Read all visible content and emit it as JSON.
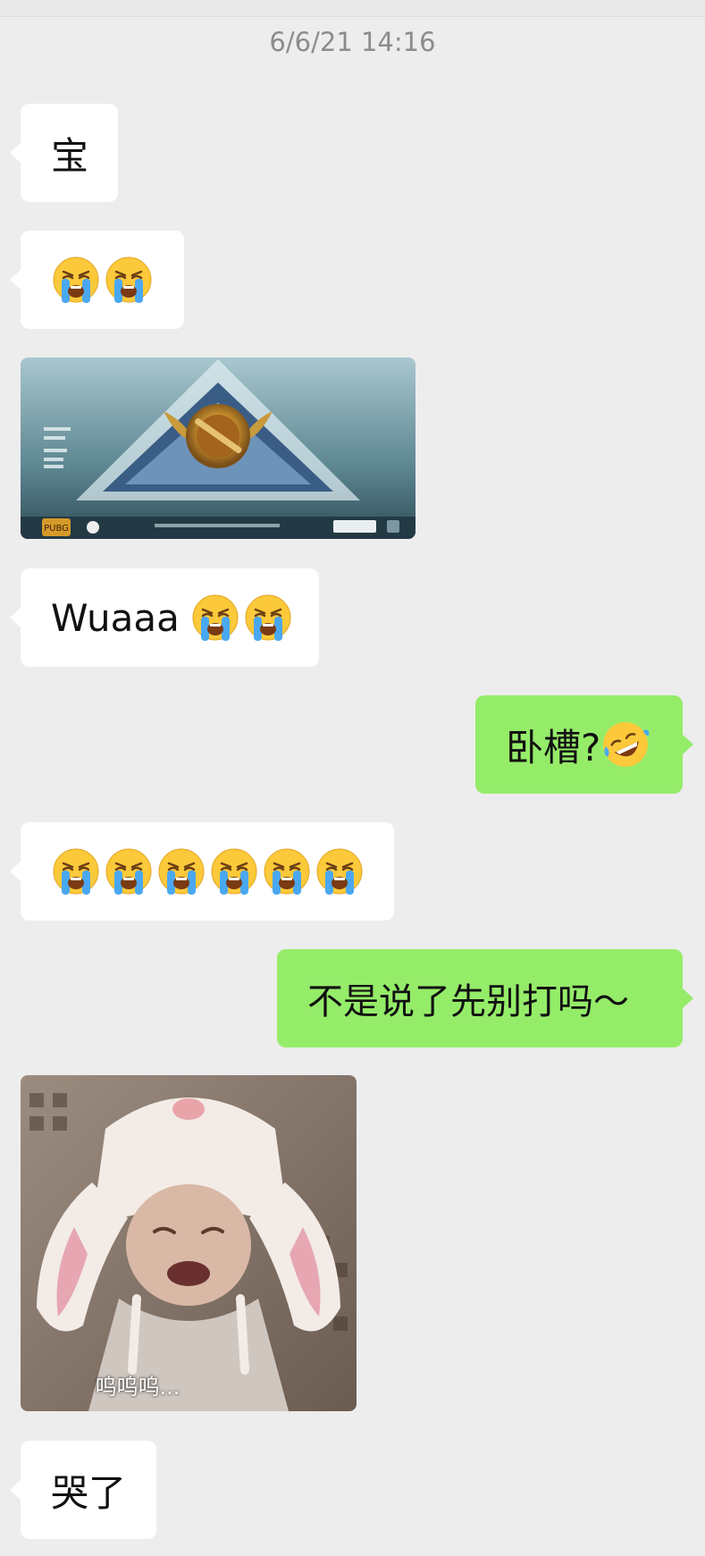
{
  "chat": {
    "timestamp": "6/6/21 14:16",
    "messages": [
      {
        "sender": "them",
        "text": "宝"
      },
      {
        "sender": "them",
        "emoji": [
          "loudly-crying-face",
          "loudly-crying-face"
        ]
      },
      {
        "sender": "them",
        "image": "game-rank-screenshot"
      },
      {
        "sender": "them",
        "text": "Wuaaa",
        "emoji": [
          "loudly-crying-face",
          "loudly-crying-face"
        ]
      },
      {
        "sender": "me",
        "text": "卧槽?",
        "emoji": [
          "rolling-on-floor-laughing-face"
        ]
      },
      {
        "sender": "them",
        "emoji": [
          "loudly-crying-face",
          "loudly-crying-face",
          "loudly-crying-face",
          "loudly-crying-face",
          "loudly-crying-face",
          "loudly-crying-face"
        ]
      },
      {
        "sender": "me",
        "text": "不是说了先别打吗～"
      },
      {
        "sender": "them",
        "image": "crying-child-bunny-hat-sticker",
        "caption": "呜呜呜..."
      },
      {
        "sender": "them",
        "text": "哭了"
      }
    ]
  },
  "screenshot_text": {
    "logo": "PUBG"
  },
  "colors": {
    "background": "#ededed",
    "incoming_bubble": "#ffffff",
    "outgoing_bubble": "#95ec69",
    "timestamp": "#8c8c8c"
  }
}
